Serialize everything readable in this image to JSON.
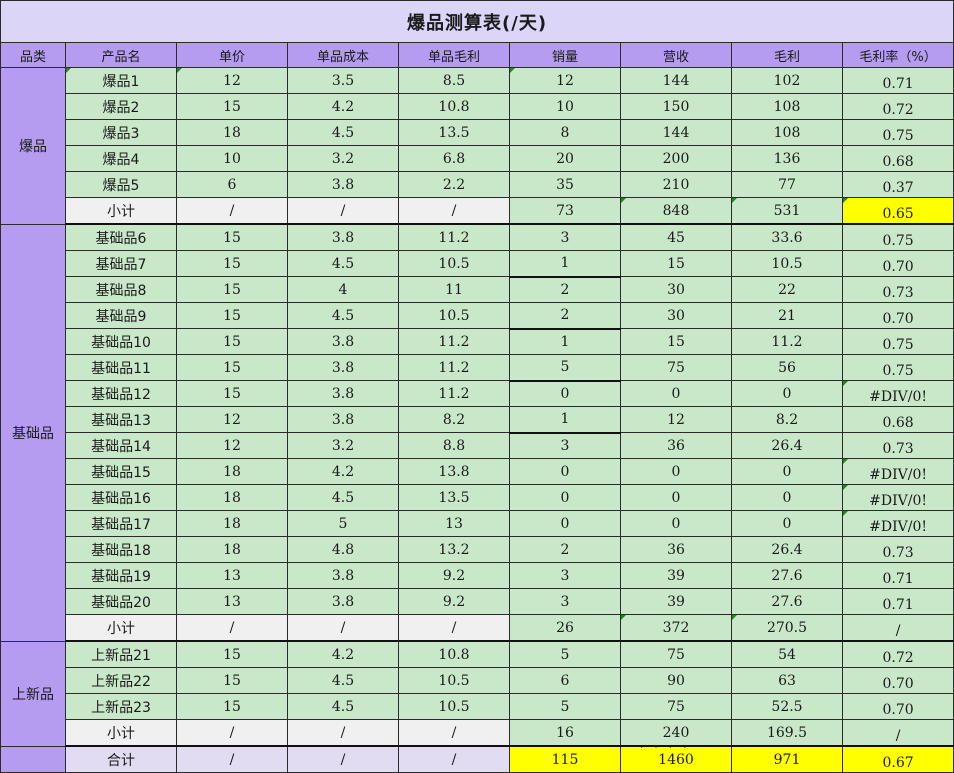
{
  "title": "爆品测算表(/天)",
  "headers": [
    "品类",
    "产品名",
    "单价",
    "单品成本",
    "单品毛利",
    "销量",
    "营收",
    "毛利",
    "毛利率（%）"
  ],
  "groups": [
    {
      "category": "爆品",
      "items": [
        {
          "name": "爆品1",
          "price": "12",
          "cost": "3.5",
          "profit": "8.5",
          "sales": "12",
          "revenue": "144",
          "gross": "102",
          "rate": "0.71"
        },
        {
          "name": "爆品2",
          "price": "15",
          "cost": "4.2",
          "profit": "10.8",
          "sales": "10",
          "revenue": "150",
          "gross": "108",
          "rate": "0.72"
        },
        {
          "name": "爆品3",
          "price": "18",
          "cost": "4.5",
          "profit": "13.5",
          "sales": "8",
          "revenue": "144",
          "gross": "108",
          "rate": "0.75"
        },
        {
          "name": "爆品4",
          "price": "10",
          "cost": "3.2",
          "profit": "6.8",
          "sales": "20",
          "revenue": "200",
          "gross": "136",
          "rate": "0.68"
        },
        {
          "name": "爆品5",
          "price": "6",
          "cost": "3.8",
          "profit": "2.2",
          "sales": "35",
          "revenue": "210",
          "gross": "77",
          "rate": "0.37"
        }
      ],
      "subtotal": {
        "name": "小计",
        "price": "/",
        "cost": "/",
        "profit": "/",
        "sales": "73",
        "revenue": "848",
        "gross": "531",
        "rate": "0.65"
      }
    },
    {
      "category": "基础品",
      "items": [
        {
          "name": "基础品6",
          "price": "15",
          "cost": "3.8",
          "profit": "11.2",
          "sales": "3",
          "revenue": "45",
          "gross": "33.6",
          "rate": "0.75"
        },
        {
          "name": "基础品7",
          "price": "15",
          "cost": "4.5",
          "profit": "10.5",
          "sales": "1",
          "revenue": "15",
          "gross": "10.5",
          "rate": "0.70"
        },
        {
          "name": "基础品8",
          "price": "15",
          "cost": "4",
          "profit": "11",
          "sales": "2",
          "revenue": "30",
          "gross": "22",
          "rate": "0.73"
        },
        {
          "name": "基础品9",
          "price": "15",
          "cost": "4.5",
          "profit": "10.5",
          "sales": "2",
          "revenue": "30",
          "gross": "21",
          "rate": "0.70"
        },
        {
          "name": "基础品10",
          "price": "15",
          "cost": "3.8",
          "profit": "11.2",
          "sales": "1",
          "revenue": "15",
          "gross": "11.2",
          "rate": "0.75"
        },
        {
          "name": "基础品11",
          "price": "15",
          "cost": "3.8",
          "profit": "11.2",
          "sales": "5",
          "revenue": "75",
          "gross": "56",
          "rate": "0.75"
        },
        {
          "name": "基础品12",
          "price": "15",
          "cost": "3.8",
          "profit": "11.2",
          "sales": "0",
          "revenue": "0",
          "gross": "0",
          "rate": "#DIV/0!"
        },
        {
          "name": "基础品13",
          "price": "12",
          "cost": "3.8",
          "profit": "8.2",
          "sales": "1",
          "revenue": "12",
          "gross": "8.2",
          "rate": "0.68"
        },
        {
          "name": "基础品14",
          "price": "12",
          "cost": "3.2",
          "profit": "8.8",
          "sales": "3",
          "revenue": "36",
          "gross": "26.4",
          "rate": "0.73"
        },
        {
          "name": "基础品15",
          "price": "18",
          "cost": "4.2",
          "profit": "13.8",
          "sales": "0",
          "revenue": "0",
          "gross": "0",
          "rate": "#DIV/0!"
        },
        {
          "name": "基础品16",
          "price": "18",
          "cost": "4.5",
          "profit": "13.5",
          "sales": "0",
          "revenue": "0",
          "gross": "0",
          "rate": "#DIV/0!"
        },
        {
          "name": "基础品17",
          "price": "18",
          "cost": "5",
          "profit": "13",
          "sales": "0",
          "revenue": "0",
          "gross": "0",
          "rate": "#DIV/0!"
        },
        {
          "name": "基础品18",
          "price": "18",
          "cost": "4.8",
          "profit": "13.2",
          "sales": "2",
          "revenue": "36",
          "gross": "26.4",
          "rate": "0.73"
        },
        {
          "name": "基础品19",
          "price": "13",
          "cost": "3.8",
          "profit": "9.2",
          "sales": "3",
          "revenue": "39",
          "gross": "27.6",
          "rate": "0.71"
        },
        {
          "name": "基础品20",
          "price": "13",
          "cost": "3.8",
          "profit": "9.2",
          "sales": "3",
          "revenue": "39",
          "gross": "27.6",
          "rate": "0.71"
        }
      ],
      "subtotal": {
        "name": "小计",
        "price": "/",
        "cost": "/",
        "profit": "/",
        "sales": "26",
        "revenue": "372",
        "gross": "270.5",
        "rate": "/"
      }
    },
    {
      "category": "上新品",
      "items": [
        {
          "name": "上新品21",
          "price": "15",
          "cost": "4.2",
          "profit": "10.8",
          "sales": "5",
          "revenue": "75",
          "gross": "54",
          "rate": "0.72"
        },
        {
          "name": "上新品22",
          "price": "15",
          "cost": "4.5",
          "profit": "10.5",
          "sales": "6",
          "revenue": "90",
          "gross": "63",
          "rate": "0.70"
        },
        {
          "name": "上新品23",
          "price": "15",
          "cost": "4.5",
          "profit": "10.5",
          "sales": "5",
          "revenue": "75",
          "gross": "52.5",
          "rate": "0.70"
        }
      ],
      "subtotal": {
        "name": "小计",
        "price": "/",
        "cost": "/",
        "profit": "/",
        "sales": "16",
        "revenue": "240",
        "gross": "169.5",
        "rate": "/"
      }
    }
  ],
  "total": {
    "name": "合计",
    "price": "/",
    "cost": "/",
    "profit": "/",
    "sales": "115",
    "revenue": "1460",
    "gross": "971",
    "rate": "0.67"
  },
  "colors": {
    "title_bg": "#dbd5f7",
    "header_bg": "#b59cf0",
    "data_bg": "#c9e8c9",
    "subtotal_bg": "#f0f0f0",
    "highlight": "#ffff00",
    "error_marker": "#1e8a1e"
  }
}
